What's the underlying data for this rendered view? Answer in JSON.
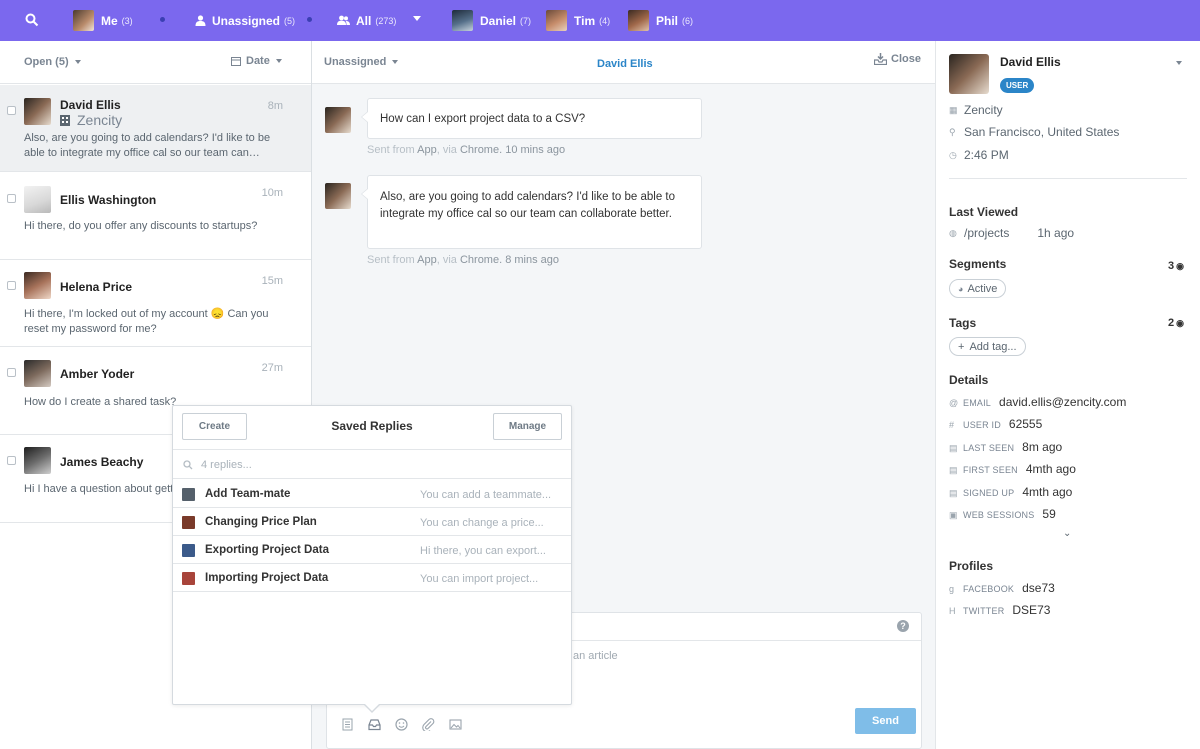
{
  "topbar": {
    "me": {
      "label": "Me",
      "count": "(3)"
    },
    "unassigned": {
      "label": "Unassigned",
      "count": "(5)"
    },
    "all": {
      "label": "All",
      "count": "(273)"
    },
    "daniel": {
      "label": "Daniel",
      "count": "(7)"
    },
    "tim": {
      "label": "Tim",
      "count": "(4)"
    },
    "phil": {
      "label": "Phil",
      "count": "(6)"
    }
  },
  "inbox": {
    "filter": "Open (5)",
    "sort": "Date",
    "conversations": [
      {
        "name": "David Ellis",
        "company": "Zencity",
        "time": "8m",
        "preview": "Also, are you going to add calendars? I'd like to be able to integrate my office cal so our team can…"
      },
      {
        "name": "Ellis Washington",
        "time": "10m",
        "preview": "Hi there, do you offer any discounts to startups?"
      },
      {
        "name": "Helena Price",
        "time": "15m",
        "preview": "Hi there, I'm locked out of my account 😞 Can you reset my password for me?"
      },
      {
        "name": "Amber Yoder",
        "time": "27m",
        "preview": "How do I create a shared task?"
      },
      {
        "name": "James Beachy",
        "time": "",
        "preview": "Hi I have a question about gett"
      }
    ]
  },
  "conversation": {
    "assignee": "Unassigned",
    "title": "David Ellis",
    "close_label": "Close",
    "messages": [
      {
        "text": "How can I export project data to a CSV?",
        "meta_prefix": "Sent from",
        "app": "App",
        "via": ", via",
        "browser": "Chrome",
        "ago": ". 10 mins ago"
      },
      {
        "text": "Also, are you going to add calendars? I'd like to be able to integrate my office cal so our team can collaborate better.",
        "meta_prefix": "Sent from",
        "app": "App",
        "via": ", via",
        "browser": "Chrome",
        "ago": ". 8 mins ago"
      }
    ],
    "composer_hint": "an article",
    "help": "?",
    "send_label": "Send"
  },
  "saved_replies": {
    "create_label": "Create",
    "title": "Saved Replies",
    "manage_label": "Manage",
    "search_placeholder": "4 replies...",
    "items": [
      {
        "title": "Add Team-mate",
        "preview": "You can add a teammate...",
        "color": "#55606b"
      },
      {
        "title": "Changing Price Plan",
        "preview": "You can change a price...",
        "color": "#7a3a2a"
      },
      {
        "title": "Exporting Project Data",
        "preview": "Hi there, you can export...",
        "color": "#3b5a8a"
      },
      {
        "title": "Importing Project Data",
        "preview": "You can import project...",
        "color": "#a8443a"
      }
    ]
  },
  "profile": {
    "name": "David Ellis",
    "badge": "USER",
    "company": "Zencity",
    "location": "San Francisco, United States",
    "local_time": "2:46 PM",
    "last_viewed_title": "Last Viewed",
    "last_viewed_page": "/projects",
    "last_viewed_ago": "1h ago",
    "segments_title": "Segments",
    "segments_count": "3",
    "segment": "Active",
    "tags_title": "Tags",
    "tags_count": "2",
    "add_tag": "Add tag...",
    "details_title": "Details",
    "details": [
      {
        "key": "EMAIL",
        "value": "david.ellis@zencity.com"
      },
      {
        "key": "USER ID",
        "value": "62555"
      },
      {
        "key": "LAST SEEN",
        "value": "8m ago"
      },
      {
        "key": "FIRST SEEN",
        "value": "4mth ago"
      },
      {
        "key": "SIGNED UP",
        "value": "4mth ago"
      },
      {
        "key": "WEB SESSIONS",
        "value": "59"
      }
    ],
    "profiles_title": "Profiles",
    "profiles": [
      {
        "icon": "g",
        "key": "FACEBOOK",
        "value": "dse73"
      },
      {
        "icon": "H",
        "key": "TWITTER",
        "value": "DSE73"
      }
    ]
  },
  "colors": {
    "topbar": "#7b68ee",
    "accent": "#2b85c8",
    "send": "#7fbde8"
  }
}
